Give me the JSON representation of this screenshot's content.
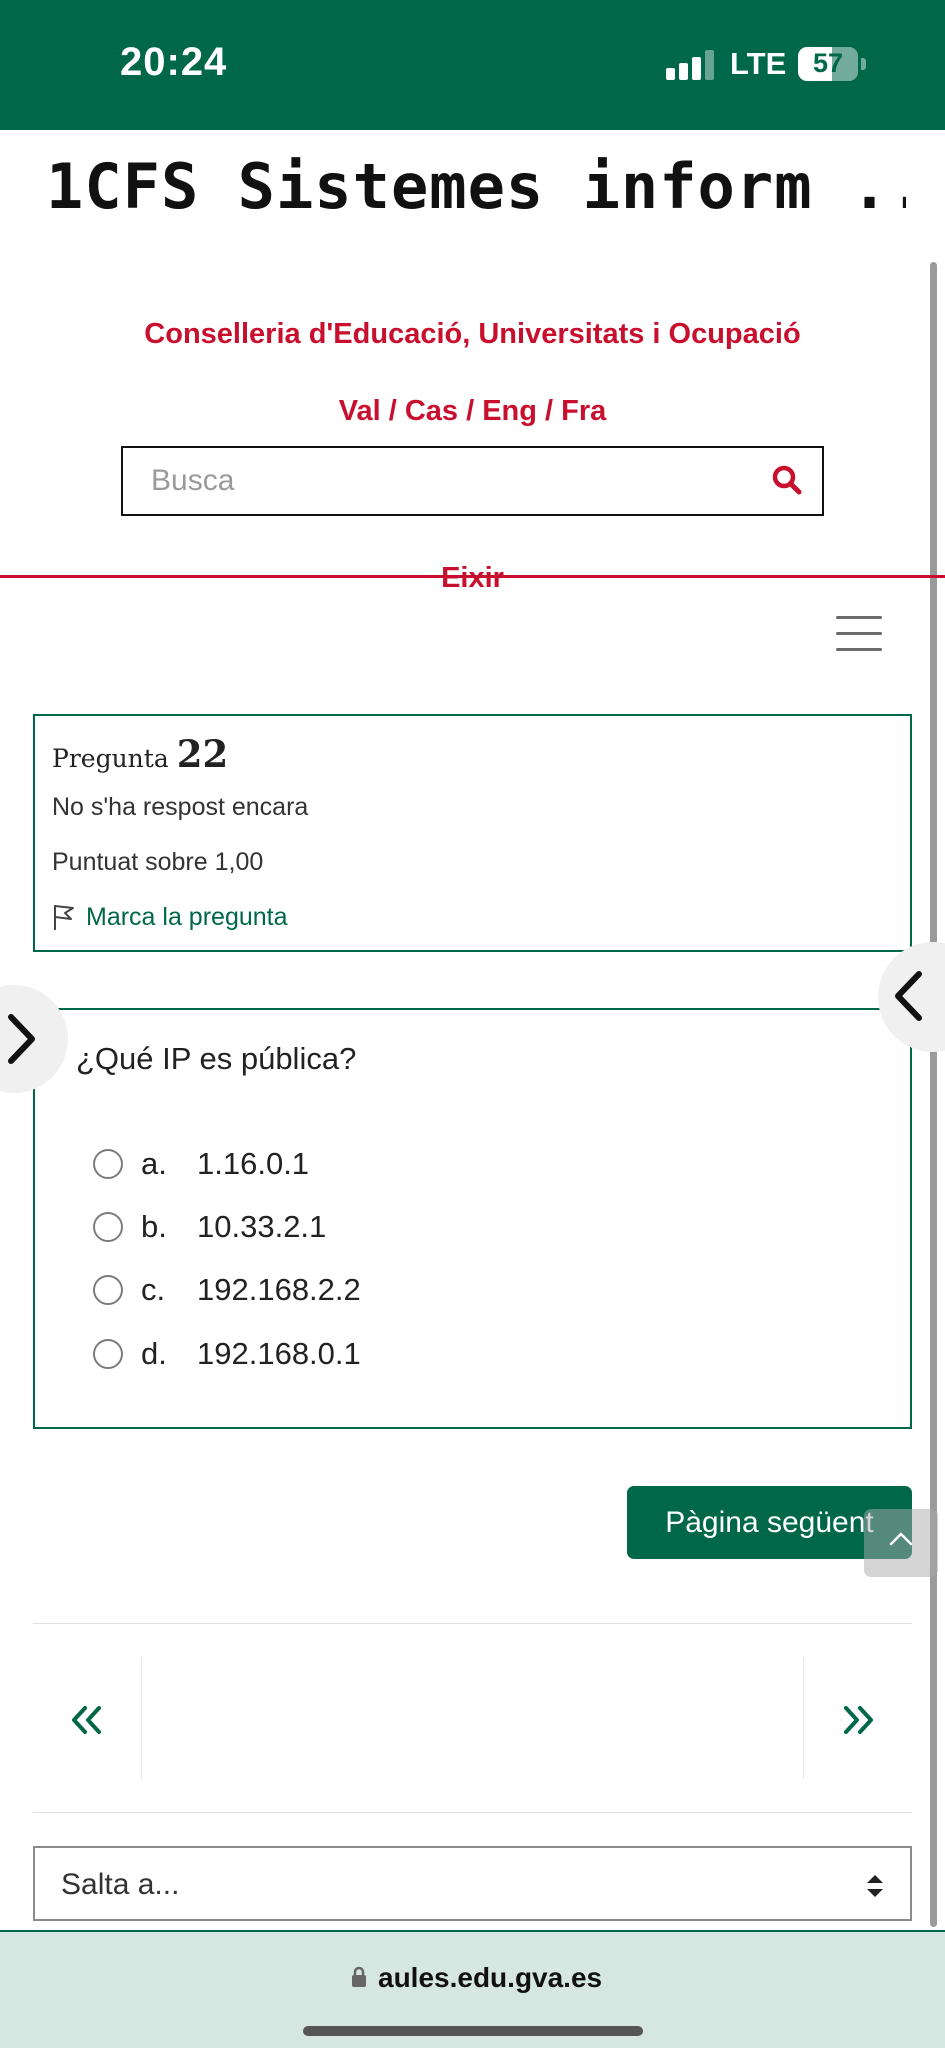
{
  "status_bar": {
    "time": "20:24",
    "network": "LTE",
    "battery_percent": "57",
    "background_color": "#006848"
  },
  "header": {
    "course_title": "1CFS Sistemes inform ...",
    "org_link": "Conselleria d'Educació, Universitats i Ocupació",
    "languages": "Val / Cas / Eng / Fra",
    "search": {
      "placeholder": "Busca",
      "value": "",
      "icon": "search-icon"
    },
    "exit_link": "Eixir",
    "menu_icon": "hamburger-icon",
    "link_color": "#c8102e"
  },
  "question_info": {
    "label": "Pregunta",
    "number": "22",
    "state": "No s'ha respost encara",
    "grade": "Puntuat sobre 1,00",
    "flag_label": "Marca la pregunta",
    "flag_icon": "flag-icon",
    "accent_color": "#006848"
  },
  "question": {
    "text": "¿Qué IP es pública?",
    "answers": [
      {
        "letter": "a.",
        "text": "1.16.0.1",
        "selected": false
      },
      {
        "letter": "b.",
        "text": "10.33.2.1",
        "selected": false
      },
      {
        "letter": "c.",
        "text": "192.168.2.2",
        "selected": false
      },
      {
        "letter": "d.",
        "text": "192.168.0.1",
        "selected": false
      }
    ]
  },
  "actions": {
    "next_page": "Pàgina següent",
    "back_to_top_icon": "chevron-up-icon"
  },
  "drawers": {
    "left_icon": "chevron-right-icon",
    "right_icon": "chevron-left-icon"
  },
  "navigation": {
    "prev_icon": "double-chevron-left-icon",
    "next_icon": "double-chevron-right-icon",
    "jump_to": "Salta a..."
  },
  "browser": {
    "url": "aules.edu.gva.es",
    "lock_icon": "lock-icon"
  }
}
